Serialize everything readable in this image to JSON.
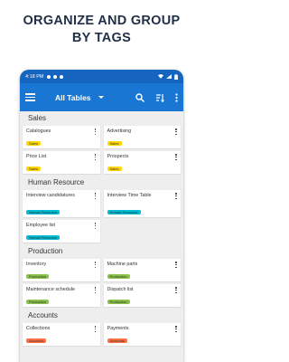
{
  "headline": {
    "line1": "ORGANIZE AND GROUP",
    "line2": "BY TAGS"
  },
  "status": {
    "time": "4:18 PM"
  },
  "appbar": {
    "title": "All Tables"
  },
  "colors": {
    "appbar": "#1976d2",
    "statusbar": "#1565c0",
    "sales_tag": "#ffd600",
    "hr_tag": "#00bcd4",
    "production_tag": "#8bc34a",
    "accounts_tag": "#ff7043"
  },
  "groups": [
    {
      "title": "Sales",
      "tag": "Sales",
      "items": [
        "Catalogues",
        "Advertising",
        "Price List",
        "Prospects"
      ]
    },
    {
      "title": "Human Resource",
      "tag": "Human Resource",
      "items": [
        "Interview candidatures",
        "Interview Time Table",
        "Employee list"
      ]
    },
    {
      "title": "Production",
      "tag": "Production",
      "items": [
        "Inventory",
        "Machine parts",
        "Maintenance schedule",
        "Dispatch list"
      ]
    },
    {
      "title": "Accounts",
      "tag": "Accounts",
      "items": [
        "Collections",
        "Payments"
      ]
    }
  ]
}
